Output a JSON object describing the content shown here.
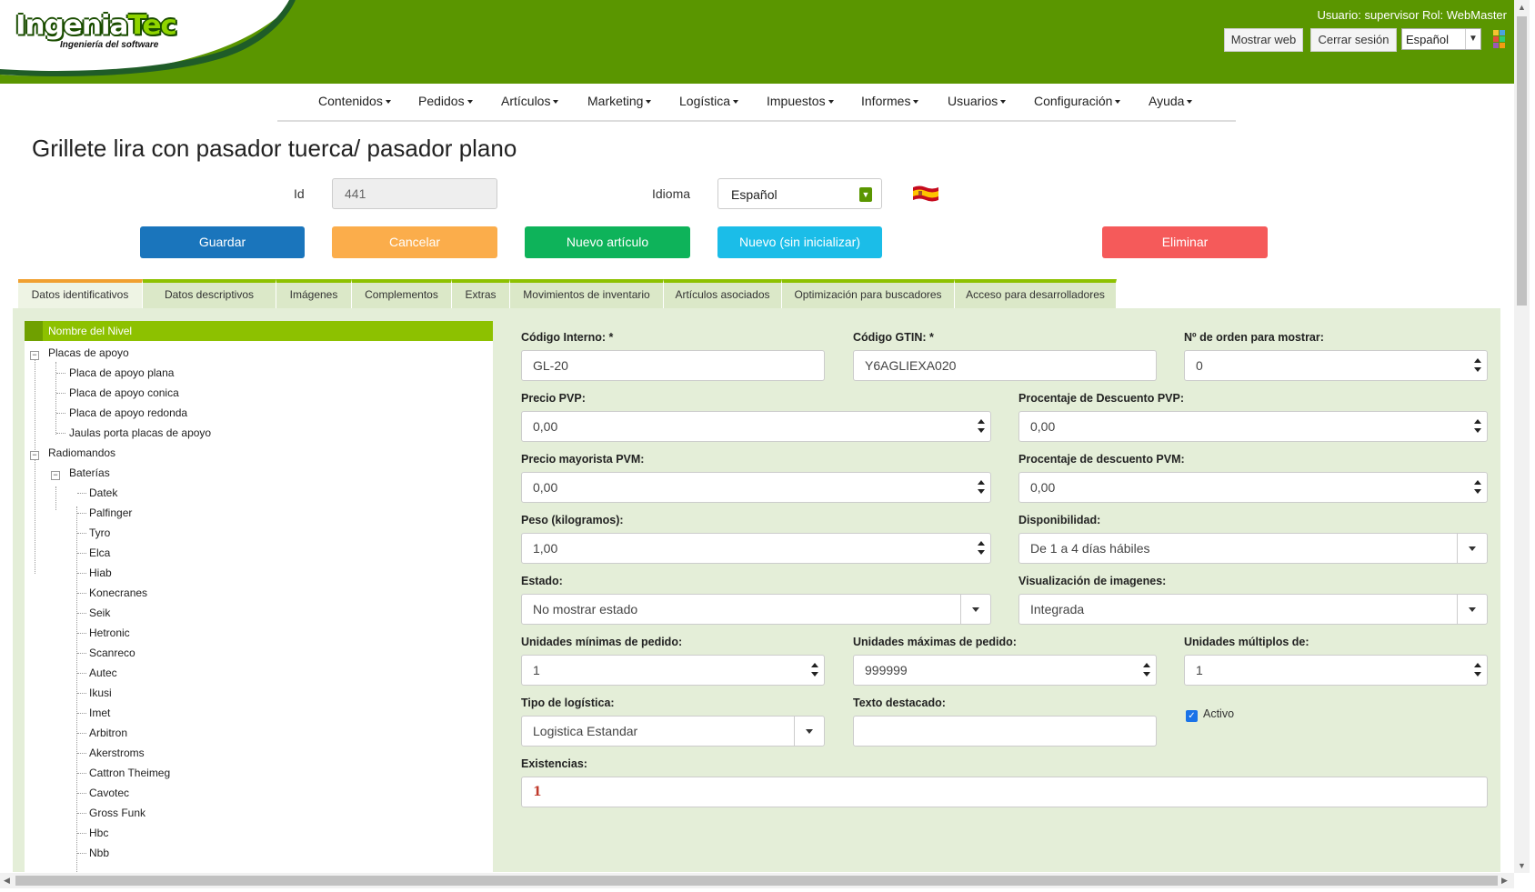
{
  "header": {
    "logo_main": "Ingenia",
    "logo_accent": "Tec",
    "logo_sub": "Ingeniería del software",
    "user_info": "Usuario: supervisor Rol: WebMaster",
    "show_web": "Mostrar web",
    "logout": "Cerrar sesión",
    "language": "Español",
    "brand_color": "#5a9600"
  },
  "nav": [
    "Contenidos",
    "Pedidos",
    "Artículos",
    "Marketing",
    "Logística",
    "Impuestos",
    "Informes",
    "Usuarios",
    "Configuración",
    "Ayuda"
  ],
  "page": {
    "title": "Grillete lira con pasador tuerca/ pasador plano",
    "id_label": "Id",
    "id_value": "441",
    "lang_label": "Idioma",
    "lang_value": "Español"
  },
  "actions": {
    "save": "Guardar",
    "cancel": "Cancelar",
    "new_item": "Nuevo artículo",
    "new_blank": "Nuevo (sin inicializar)",
    "delete": "Eliminar"
  },
  "tabs": [
    "Datos identificativos",
    "Datos descriptivos",
    "Imágenes",
    "Complementos",
    "Extras",
    "Movimientos de inventario",
    "Artículos asociados",
    "Optimización para buscadores",
    "Acceso para desarrolladores"
  ],
  "tree": {
    "header": "Nombre del Nivel",
    "nodes": [
      "Placas de apoyo",
      "Placa de apoyo plana",
      "Placa de apoyo conica",
      "Placa de apoyo redonda",
      "Jaulas porta placas de apoyo",
      "Radiomandos",
      "Baterías",
      "Datek",
      "Palfinger",
      "Tyro",
      "Elca",
      "Hiab",
      "Konecranes",
      "Seik",
      "Hetronic",
      "Scanreco",
      "Autec",
      "Ikusi",
      "Imet",
      "Arbitron",
      "Akerstroms",
      "Cattron Theimeg",
      "Cavotec",
      "Gross Funk",
      "Hbc",
      "Nbb"
    ]
  },
  "form": {
    "codigo_interno": {
      "label": "Código Interno: *",
      "value": "GL-20"
    },
    "codigo_gtin": {
      "label": "Código GTIN: *",
      "value": "Y6AGLIEXA020"
    },
    "orden": {
      "label": "Nº de orden para mostrar:",
      "value": "0"
    },
    "precio_pvp": {
      "label": "Precio PVP:",
      "value": "0,00"
    },
    "desc_pvp": {
      "label": "Procentaje de Descuento PVP:",
      "value": "0,00"
    },
    "precio_pvm": {
      "label": "Precio mayorista PVM:",
      "value": "0,00"
    },
    "desc_pvm": {
      "label": "Procentaje de descuento PVM:",
      "value": "0,00"
    },
    "peso": {
      "label": "Peso (kilogramos):",
      "value": "1,00"
    },
    "disponibilidad": {
      "label": "Disponibilidad:",
      "value": "De 1 a 4 días hábiles"
    },
    "estado": {
      "label": "Estado:",
      "value": "No mostrar estado"
    },
    "visualizacion": {
      "label": "Visualización de imagenes:",
      "value": "Integrada"
    },
    "uds_min": {
      "label": "Unidades mínimas de pedido:",
      "value": "1"
    },
    "uds_max": {
      "label": "Unidades máximas de pedido:",
      "value": "999999"
    },
    "uds_mult": {
      "label": "Unidades múltiplos de:",
      "value": "1"
    },
    "logistica": {
      "label": "Tipo de logística:",
      "value": "Logistica Estandar"
    },
    "destacado": {
      "label": "Texto destacado:",
      "value": ""
    },
    "activo": {
      "label": "Activo",
      "checked": true
    },
    "existencias": {
      "label": "Existencias:",
      "value": "1"
    }
  }
}
